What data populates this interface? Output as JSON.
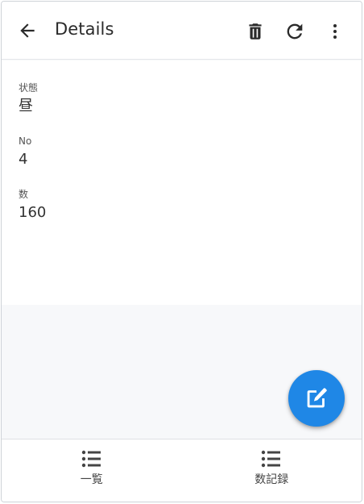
{
  "header": {
    "title": "Details",
    "back_icon": "arrow-left-icon",
    "actions": [
      {
        "name": "delete",
        "icon": "trash-icon"
      },
      {
        "name": "refresh",
        "icon": "refresh-icon"
      },
      {
        "name": "more",
        "icon": "more-vertical-icon"
      }
    ]
  },
  "fields": [
    {
      "label": "状態",
      "value": "昼"
    },
    {
      "label": "No",
      "value": "4"
    },
    {
      "label": "数",
      "value": "160"
    }
  ],
  "fab": {
    "icon": "edit-icon",
    "color": "#1f87e6"
  },
  "bottom_nav": [
    {
      "label": "一覧",
      "icon": "list-icon"
    },
    {
      "label": "数記録",
      "icon": "list-icon"
    }
  ]
}
